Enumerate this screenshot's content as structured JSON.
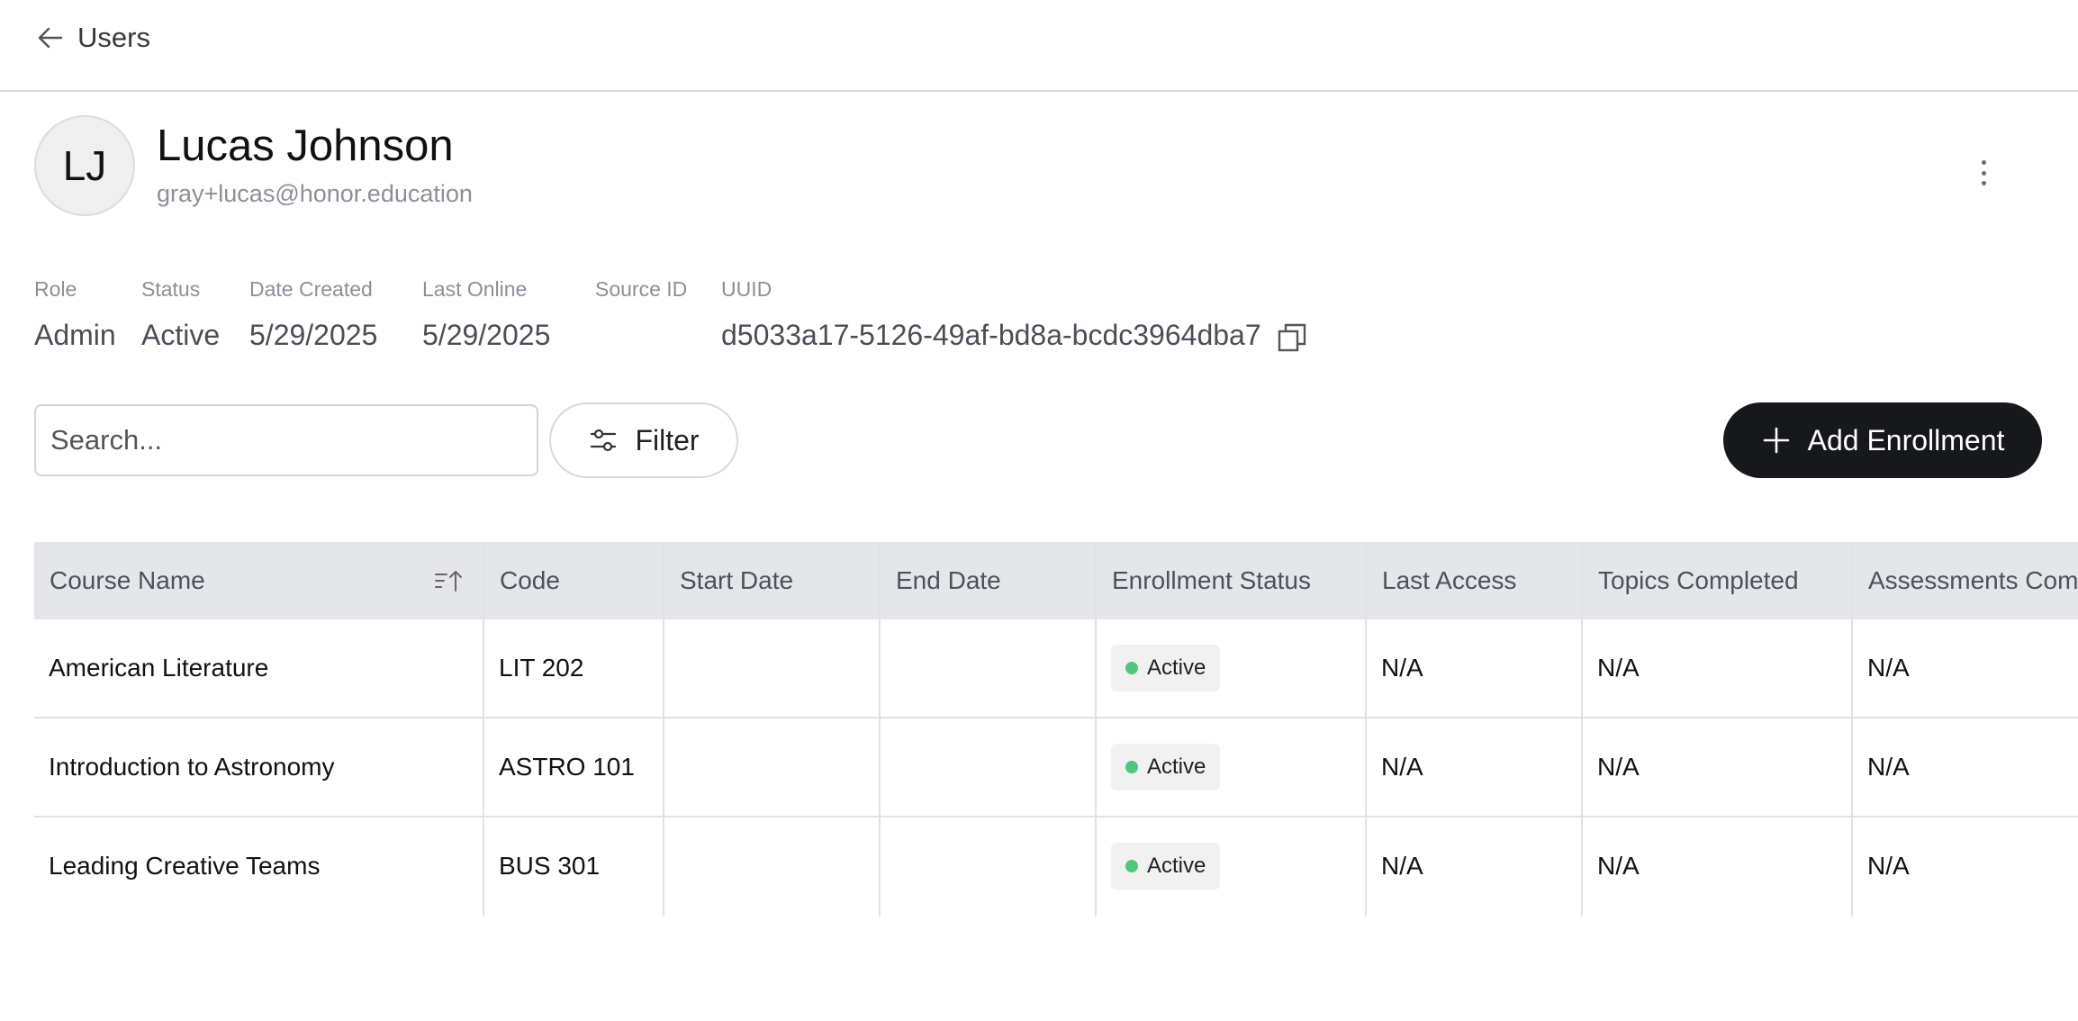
{
  "header": {
    "back_label": "Users"
  },
  "user": {
    "initials": "LJ",
    "name": "Lucas Johnson",
    "email": "gray+lucas@honor.education"
  },
  "meta": {
    "role_label": "Role",
    "role_value": "Admin",
    "status_label": "Status",
    "status_value": "Active",
    "created_label": "Date Created",
    "created_value": "5/29/2025",
    "online_label": "Last Online",
    "online_value": "5/29/2025",
    "source_label": "Source ID",
    "source_value": "",
    "uuid_label": "UUID",
    "uuid_value": "d5033a17-5126-49af-bd8a-bcdc3964dba7"
  },
  "toolbar": {
    "search_placeholder": "Search...",
    "filter_label": "Filter",
    "add_label": "Add Enrollment"
  },
  "table": {
    "columns": [
      "Course Name",
      "Code",
      "Start Date",
      "End Date",
      "Enrollment Status",
      "Last Access",
      "Topics Completed",
      "Assessments Comp"
    ],
    "rows": [
      {
        "course": "American Literature",
        "code": "LIT 202",
        "start": "",
        "end": "",
        "status": "Active",
        "last_access": "N/A",
        "topics": "N/A",
        "assessments": "N/A"
      },
      {
        "course": "Introduction to Astronomy",
        "code": "ASTRO 101",
        "start": "",
        "end": "",
        "status": "Active",
        "last_access": "N/A",
        "topics": "N/A",
        "assessments": "N/A"
      },
      {
        "course": "Leading Creative Teams",
        "code": "BUS 301",
        "start": "",
        "end": "",
        "status": "Active",
        "last_access": "N/A",
        "topics": "N/A",
        "assessments": "N/A"
      }
    ]
  },
  "colors": {
    "accent_dark": "#16181b",
    "status_active": "#4cc97a",
    "header_bg": "#e5e6ea"
  },
  "icons": [
    "arrow-left-icon",
    "more-vertical-icon",
    "copy-icon",
    "filter-sliders-icon",
    "plus-icon",
    "sort-ascending-icon"
  ]
}
